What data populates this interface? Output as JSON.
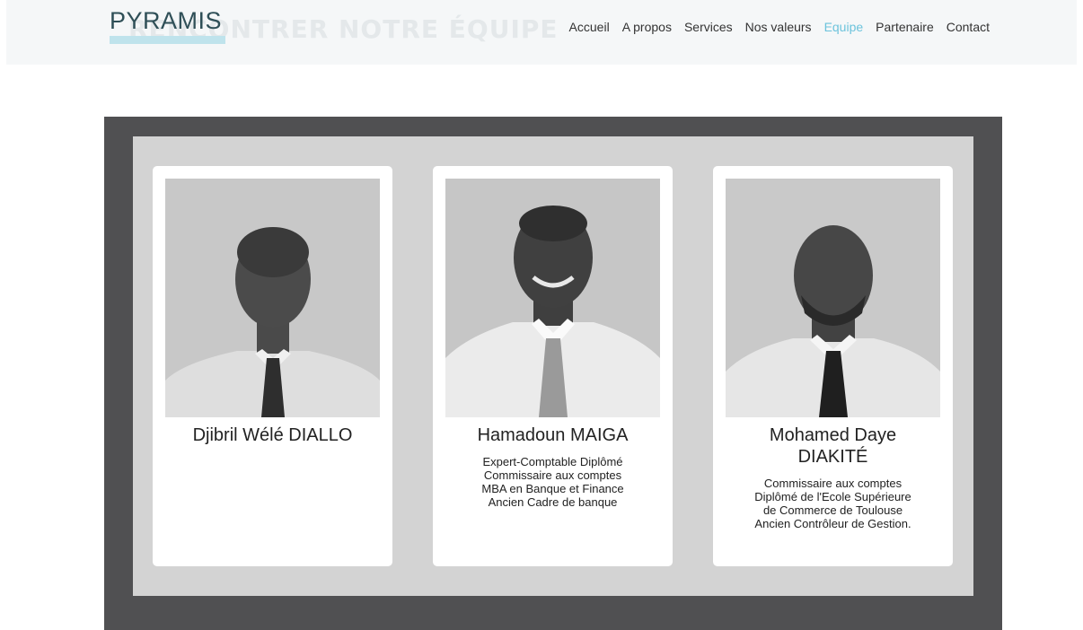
{
  "header": {
    "logo": "PYRAMIS",
    "section_watermark": "RENCONTRER NOTRE ÉQUIPE",
    "nav": [
      {
        "label": "Accueil",
        "active": false
      },
      {
        "label": "A propos",
        "active": false
      },
      {
        "label": "Services",
        "active": false
      },
      {
        "label": "Nos valeurs",
        "active": false
      },
      {
        "label": "Equipe",
        "active": true
      },
      {
        "label": "Partenaire",
        "active": false
      },
      {
        "label": "Contact",
        "active": false
      }
    ],
    "accent_color": "#6cc3dc"
  },
  "team": [
    {
      "name_lines": [
        "Djibril Wélé DIALLO"
      ],
      "description": []
    },
    {
      "name_lines": [
        "Hamadoun MAIGA"
      ],
      "description": [
        "Expert-Comptable Diplômé",
        "Commissaire aux comptes",
        "MBA en Banque et Finance",
        "Ancien Cadre de banque"
      ]
    },
    {
      "name_lines": [
        "Mohamed Daye",
        "DIAKITÉ"
      ],
      "description": [
        "Commissaire aux comptes",
        "Diplômé de l'Ecole Supérieure",
        "de Commerce de Toulouse",
        "Ancien Contrôleur de Gestion."
      ]
    }
  ]
}
